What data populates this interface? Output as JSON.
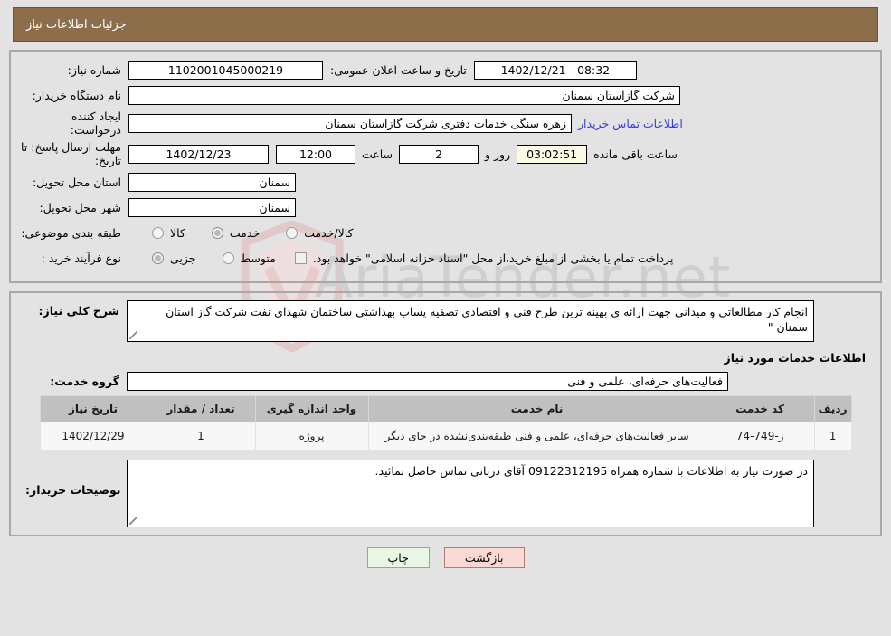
{
  "header": {
    "title": "جزئیات اطلاعات نیاز"
  },
  "watermark": {
    "text": "AriaTender.net",
    "sub": ""
  },
  "form": {
    "need_number_label": "شماره نیاز:",
    "need_number_value": "1102001045000219",
    "public_announce_label": "تاریخ و ساعت اعلان عمومی:",
    "public_announce_value": "08:32 - 1402/12/21",
    "buyer_org_label": "نام دستگاه خریدار:",
    "buyer_org_value": "شرکت گازاستان سمنان",
    "requester_label": "ایجاد کننده درخواست:",
    "requester_value": "زهره سنگی خدمات دفتری شرکت گازاستان سمنان",
    "contact_link": "اطلاعات تماس خریدار",
    "deadline_label": "مهلت ارسال پاسخ: تا تاریخ:",
    "deadline_date": "1402/12/23",
    "hour_label": "ساعت",
    "hour_value": "12:00",
    "days_value": "2",
    "days_label": "روز و",
    "countdown_value": "03:02:51",
    "countdown_label": "ساعت باقی مانده",
    "province_label": "استان محل تحویل:",
    "province_value": "سمنان",
    "city_label": "شهر محل تحویل:",
    "city_value": "سمنان",
    "category_label": "طبقه بندی موضوعی:",
    "category_options": [
      {
        "label": "کالا",
        "selected": false
      },
      {
        "label": "خدمت",
        "selected": true
      },
      {
        "label": "کالا/خدمت",
        "selected": false
      }
    ],
    "process_label": "نوع فرآیند خرید :",
    "process_options": [
      {
        "label": "جزیی",
        "selected": true
      },
      {
        "label": "متوسط",
        "selected": false
      }
    ],
    "treasury_checkbox_label": "پرداخت تمام یا بخشی از مبلغ خرید،از محل \"اسناد خزانه اسلامی\" خواهد بود.",
    "treasury_checked": false
  },
  "description": {
    "label": "شرح کلی نیاز:",
    "value": "انجام کار مطالعاتی و میدانی جهت ارائه ی بهینه ترین طرح فنی و اقتصادی تصفیه پساب بهداشتی ساختمان شهدای نفت شرکت گاز استان سمنان \""
  },
  "services": {
    "section_title": "اطلاعات خدمات مورد نیاز",
    "group_label": "گروه خدمت:",
    "group_value": "فعالیت‌های حرفه‌ای، علمی و فنی",
    "columns": [
      "ردیف",
      "کد خدمت",
      "نام خدمت",
      "واحد اندازه گیری",
      "تعداد / مقدار",
      "تاریخ نیاز"
    ],
    "rows": [
      {
        "row_no": "1",
        "service_code": "ز-749-74",
        "service_name": "سایر فعالیت‌های حرفه‌ای، علمی و فنی طبقه‌بندی‌نشده در جای دیگر",
        "unit": "پروژه",
        "quantity": "1",
        "need_date": "1402/12/29"
      }
    ]
  },
  "notes": {
    "label": "توضیحات خریدار:",
    "value": "در صورت نیاز به اطلاعات با شماره همراه 09122312195 آقای دربانی تماس حاصل نمائید."
  },
  "buttons": {
    "print": "چاپ",
    "back": "بازگشت"
  },
  "colors": {
    "header_bg": "#8d6e4a",
    "link": "#3b3bd8",
    "print_bg": "#e8f6e3",
    "back_bg": "#fbd9d4",
    "countdown_bg": "#fbfbe3",
    "table_header_bg": "#c0c0c0"
  }
}
